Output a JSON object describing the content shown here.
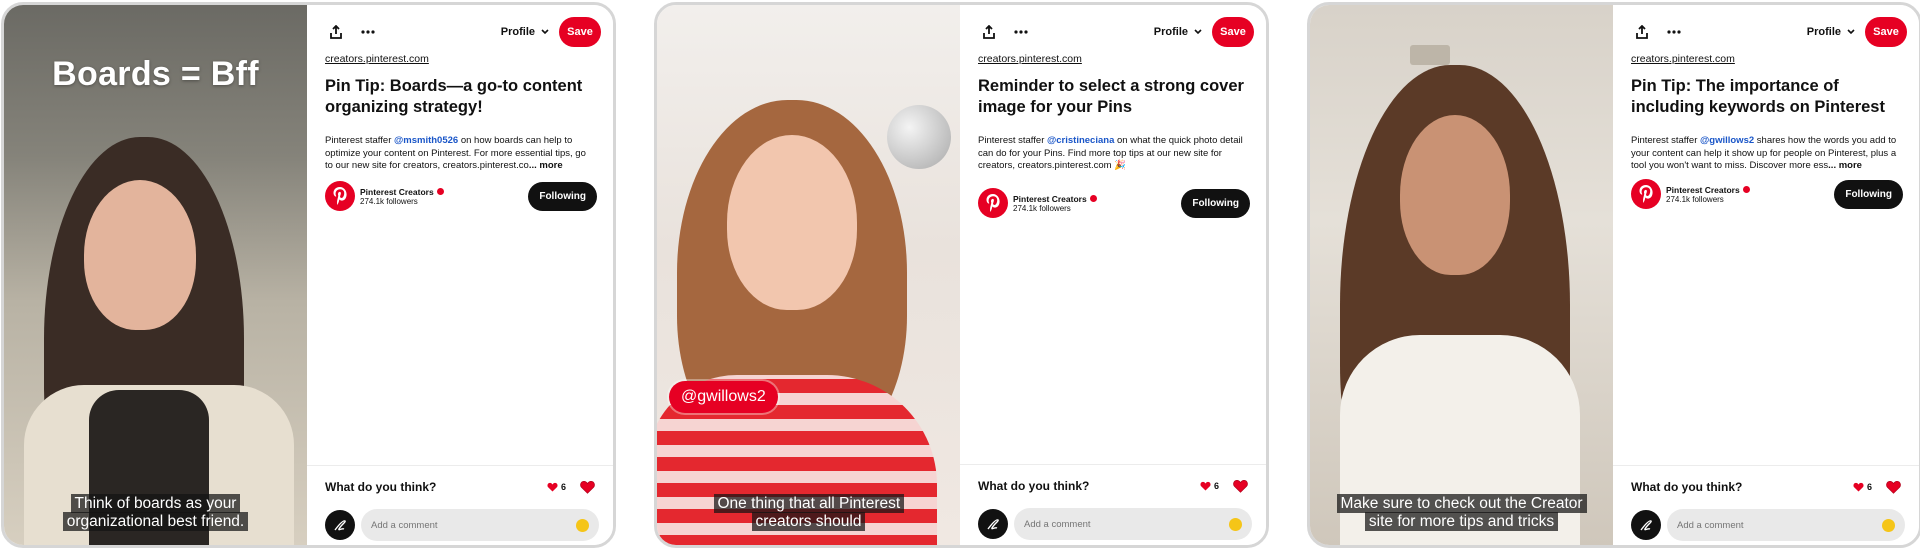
{
  "colors": {
    "brand_red": "#e60023",
    "following_button": "#111111",
    "mention": "#1a56c8",
    "card_border": "#d6d6d6"
  },
  "toolbar": {
    "share_icon": "share-icon",
    "more_icon": "ellipsis-icon",
    "profile_label": "Profile",
    "save_label": "Save"
  },
  "cards": [
    {
      "video": {
        "overlay_title": "Boards = Bff",
        "caption": "Think of boards as your organizational best friend."
      },
      "domain": "creators.pinterest.com",
      "title": "Pin Tip: Boards—a go-to content organizing strategy!",
      "desc_prefix": "Pinterest staffer ",
      "desc_mention": "@msmith0526",
      "desc_suffix": " on how boards can help to optimize your content on Pinterest. For more essential tips, go to our new site for creators, creators.pinterest.co",
      "more_label": "... more",
      "creator": {
        "name": "Pinterest Creators",
        "followers": "274.1k followers",
        "follow_label": "Following"
      },
      "comments": {
        "prompt": "What do you think?",
        "reaction_count": "6",
        "placeholder": "Add a comment"
      }
    },
    {
      "video": {
        "tag": "@gwillows2",
        "caption": "One thing that all Pinterest creators should"
      },
      "domain": "creators.pinterest.com",
      "title": "Reminder to select a strong cover image for your Pins",
      "desc_prefix": "Pinterest staffer ",
      "desc_mention": "@cristineciana",
      "desc_suffix": " on what the quick photo detail can do for your Pins. Find more top tips at our new site for creators, creators.pinterest.com 🎉",
      "more_label": "",
      "creator": {
        "name": "Pinterest Creators",
        "followers": "274.1k followers",
        "follow_label": "Following"
      },
      "comments": {
        "prompt": "What do you think?",
        "reaction_count": "6",
        "placeholder": "Add a comment"
      }
    },
    {
      "video": {
        "caption": "Make sure to check out the Creator site for more tips and tricks"
      },
      "domain": "creators.pinterest.com",
      "title": "Pin Tip: The importance of including keywords on Pinterest",
      "desc_prefix": "Pinterest staffer ",
      "desc_mention": "@gwillows2",
      "desc_suffix": " shares how the words you add to your content can help it show up for people on Pinterest, plus a tool you won't want to miss. Discover more ess",
      "more_label": "... more",
      "creator": {
        "name": "Pinterest Creators",
        "followers": "274.1k followers",
        "follow_label": "Following"
      },
      "comments": {
        "prompt": "What do you think?",
        "reaction_count": "6",
        "placeholder": "Add a comment"
      }
    }
  ]
}
